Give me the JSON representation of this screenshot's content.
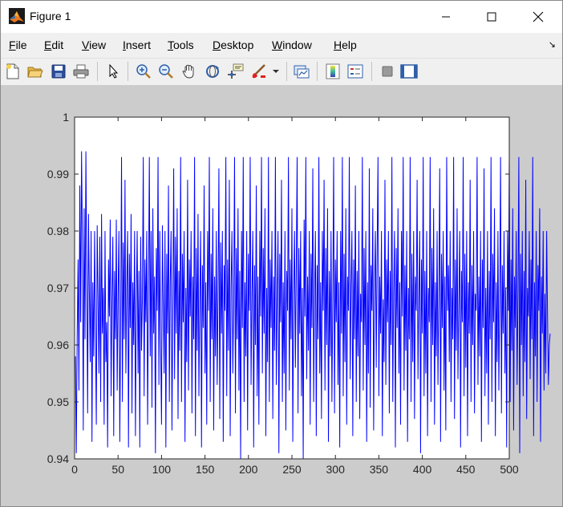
{
  "window": {
    "title": "Figure 1"
  },
  "menu": {
    "file": {
      "u": "F",
      "rest": "ile"
    },
    "edit": {
      "u": "E",
      "rest": "dit"
    },
    "view": {
      "u": "V",
      "rest": "iew"
    },
    "insert": {
      "u": "I",
      "rest": "nsert"
    },
    "tools": {
      "u": "T",
      "rest": "ools"
    },
    "desktop": {
      "u": "D",
      "rest": "esktop"
    },
    "window": {
      "u": "W",
      "rest": "indow"
    },
    "help": {
      "u": "H",
      "rest": "elp"
    }
  },
  "toolbar_icons": [
    "new-figure-icon",
    "open-file-icon",
    "save-icon",
    "print-icon",
    "edit-plot-arrow-icon",
    "zoom-in-icon",
    "zoom-out-icon",
    "pan-hand-icon",
    "rotate-3d-icon",
    "data-cursor-icon",
    "brush-icon",
    "link-plot-icon",
    "insert-colorbar-icon",
    "insert-legend-icon",
    "hide-plot-tools-icon",
    "show-plot-tools-icon"
  ],
  "colors": {
    "line": "#0000ff",
    "figure_bg": "#cccccc",
    "axes_bg": "#ffffff"
  },
  "chart_data": {
    "type": "line",
    "title": "",
    "xlabel": "",
    "ylabel": "",
    "xlim": [
      0,
      500
    ],
    "ylim": [
      0.94,
      1.0
    ],
    "xticks": [
      0,
      50,
      100,
      150,
      200,
      250,
      300,
      350,
      400,
      450,
      500
    ],
    "yticks": [
      0.94,
      0.95,
      0.96,
      0.97,
      0.98,
      0.99,
      1
    ],
    "xtick_labels": [
      "0",
      "50",
      "100",
      "150",
      "200",
      "250",
      "300",
      "350",
      "400",
      "450",
      "500"
    ],
    "ytick_labels": [
      "0.94",
      "0.95",
      "0.96",
      "0.97",
      "0.98",
      "0.99",
      "1"
    ],
    "grid": false,
    "series": [
      {
        "x_start": 1,
        "x_step": 1,
        "y": [
          0.958,
          0.941,
          0.962,
          0.975,
          0.952,
          0.988,
          0.964,
          0.994,
          0.978,
          0.945,
          0.984,
          0.961,
          0.994,
          0.972,
          0.948,
          0.983,
          0.969,
          0.957,
          0.98,
          0.943,
          0.971,
          0.958,
          0.98,
          0.962,
          0.946,
          0.981,
          0.968,
          0.955,
          0.979,
          0.95,
          0.983,
          0.962,
          0.97,
          0.946,
          0.98,
          0.957,
          0.964,
          0.942,
          0.975,
          0.965,
          0.982,
          0.951,
          0.968,
          0.979,
          0.944,
          0.973,
          0.961,
          0.982,
          0.952,
          0.969,
          0.98,
          0.943,
          0.964,
          0.993,
          0.95,
          0.978,
          0.961,
          0.989,
          0.955,
          0.97,
          0.98,
          0.942,
          0.976,
          0.963,
          0.983,
          0.948,
          0.971,
          0.96,
          0.98,
          0.944,
          0.967,
          0.98,
          0.955,
          0.973,
          0.942,
          0.979,
          0.959,
          0.968,
          0.993,
          0.951,
          0.975,
          0.964,
          0.98,
          0.946,
          0.97,
          0.993,
          0.958,
          0.98,
          0.949,
          0.984,
          0.962,
          0.972,
          0.941,
          0.977,
          0.966,
          0.993,
          0.953,
          0.98,
          0.96,
          0.946,
          0.981,
          0.967,
          0.955,
          0.98,
          0.942,
          0.976,
          0.962,
          0.988,
          0.95,
          0.971,
          0.98,
          0.945,
          0.966,
          0.991,
          0.954,
          0.979,
          0.962,
          0.984,
          0.947,
          0.973,
          0.959,
          0.993,
          0.95,
          0.976,
          0.964,
          0.98,
          0.943,
          0.97,
          0.957,
          0.989,
          0.952,
          0.975,
          0.965,
          0.98,
          0.948,
          0.972,
          0.961,
          0.993,
          0.944,
          0.977,
          0.959,
          0.983,
          0.951,
          0.968,
          0.98,
          0.942,
          0.974,
          0.963,
          0.988,
          0.955,
          0.971,
          0.946,
          0.98,
          0.966,
          0.993,
          0.95,
          0.976,
          0.961,
          0.984,
          0.945,
          0.972,
          0.958,
          0.98,
          0.953,
          0.969,
          0.991,
          0.947,
          0.978,
          0.962,
          0.98,
          0.943,
          0.974,
          0.966,
          0.993,
          0.951,
          0.975,
          0.959,
          0.989,
          0.944,
          0.97,
          0.98,
          0.955,
          0.967,
          0.993,
          0.948,
          0.977,
          0.961,
          0.984,
          0.952,
          0.973,
          0.94,
          0.98,
          0.963,
          0.993,
          0.95,
          0.971,
          0.958,
          0.98,
          0.945,
          0.976,
          0.966,
          0.993,
          0.953,
          0.969,
          0.98,
          0.942,
          0.974,
          0.96,
          0.988,
          0.951,
          0.972,
          0.946,
          0.98,
          0.965,
          0.993,
          0.955,
          0.977,
          0.962,
          0.984,
          0.944,
          0.97,
          0.957,
          0.993,
          0.95,
          0.975,
          0.963,
          0.98,
          0.947,
          0.972,
          0.959,
          0.993,
          0.953,
          0.968,
          0.98,
          0.941,
          0.976,
          0.964,
          0.989,
          0.95,
          0.971,
          0.955,
          0.98,
          0.945,
          0.973,
          0.966,
          0.993,
          0.952,
          0.975,
          0.961,
          0.984,
          0.943,
          0.969,
          0.98,
          0.956,
          0.974,
          0.993,
          0.948,
          0.977,
          0.962,
          0.98,
          0.951,
          0.97,
          0.94,
          0.982,
          0.965,
          0.993,
          0.954,
          0.972,
          0.959,
          0.98,
          0.946,
          0.976,
          0.963,
          0.991,
          0.95,
          0.969,
          0.98,
          0.944,
          0.974,
          0.961,
          0.993,
          0.955,
          0.971,
          0.947,
          0.98,
          0.966,
          0.989,
          0.952,
          0.977,
          0.96,
          0.984,
          0.943,
          0.973,
          0.958,
          0.98,
          0.95,
          0.968,
          0.993,
          0.948,
          0.975,
          0.964,
          0.98,
          0.953,
          0.971,
          0.942,
          0.98,
          0.962,
          0.993,
          0.951,
          0.976,
          0.957,
          0.984,
          0.946,
          0.972,
          0.966,
          0.993,
          0.954,
          0.97,
          0.98,
          0.944,
          0.975,
          0.961,
          0.988,
          0.95,
          0.973,
          0.958,
          0.98,
          0.947,
          0.969,
          0.964,
          0.993,
          0.952,
          0.977,
          0.96,
          0.98,
          0.943,
          0.971,
          0.955,
          0.991,
          0.949,
          0.974,
          0.966,
          0.984,
          0.945,
          0.97,
          0.98,
          0.956,
          0.976,
          0.993,
          0.951,
          0.972,
          0.962,
          0.98,
          0.944,
          0.968,
          0.957,
          0.989,
          0.953,
          0.975,
          0.964,
          0.98,
          0.948,
          0.973,
          0.96,
          0.993,
          0.95,
          0.969,
          0.98,
          0.942,
          0.977,
          0.963,
          0.984,
          0.955,
          0.971,
          0.946,
          0.98,
          0.965,
          0.993,
          0.952,
          0.974,
          0.959,
          0.98,
          0.943,
          0.97,
          0.961,
          0.993,
          0.95,
          0.976,
          0.957,
          0.98,
          0.947,
          0.972,
          0.966,
          0.989,
          0.954,
          0.968,
          0.98,
          0.941,
          0.975,
          0.962,
          0.993,
          0.951,
          0.973,
          0.955,
          0.98,
          0.944,
          0.97,
          0.964,
          0.993,
          0.95,
          0.977,
          0.96,
          0.984,
          0.946,
          0.971,
          0.958,
          0.98,
          0.953,
          0.969,
          0.991,
          0.943,
          0.976,
          0.963,
          0.98,
          0.952,
          0.972,
          0.945,
          0.993,
          0.966,
          0.974,
          0.957,
          0.98,
          0.95,
          0.97,
          0.961,
          0.993,
          0.947,
          0.975,
          0.959,
          0.984,
          0.954,
          0.968,
          0.98,
          0.942,
          0.973,
          0.964,
          0.993,
          0.951,
          0.976,
          0.956,
          0.98,
          0.944,
          0.971,
          0.962,
          0.989,
          0.95,
          0.974,
          0.96,
          0.98,
          0.948,
          0.969,
          0.966,
          0.993,
          0.953,
          0.972,
          0.958,
          0.98,
          0.943,
          0.975,
          0.963,
          0.991,
          0.951,
          0.97,
          0.955,
          0.98,
          0.946,
          0.973,
          0.961,
          0.993,
          0.95,
          0.976,
          0.964,
          0.984,
          0.944,
          0.971,
          0.957,
          0.98,
          0.952,
          0.968,
          0.993,
          0.948,
          0.974,
          0.962,
          0.98,
          0.955,
          0.97,
          0.942,
          0.98,
          0.966,
          0.993,
          0.95,
          0.975,
          0.959,
          0.984,
          0.945,
          0.972,
          0.963,
          0.98,
          0.953,
          0.969,
          0.993,
          0.941,
          0.976,
          0.96,
          0.98,
          0.951,
          0.973,
          0.957,
          0.989,
          0.947,
          0.97,
          0.965,
          0.98,
          0.954,
          0.975,
          0.961,
          0.993,
          0.944,
          0.971,
          0.958,
          0.98,
          0.95,
          0.974,
          0.966,
          0.984,
          0.943,
          0.972,
          0.962,
          0.98,
          0.952,
          0.969,
          0.955,
          0.98,
          0.965,
          0.953,
          0.96,
          0.962
        ]
      }
    ]
  }
}
